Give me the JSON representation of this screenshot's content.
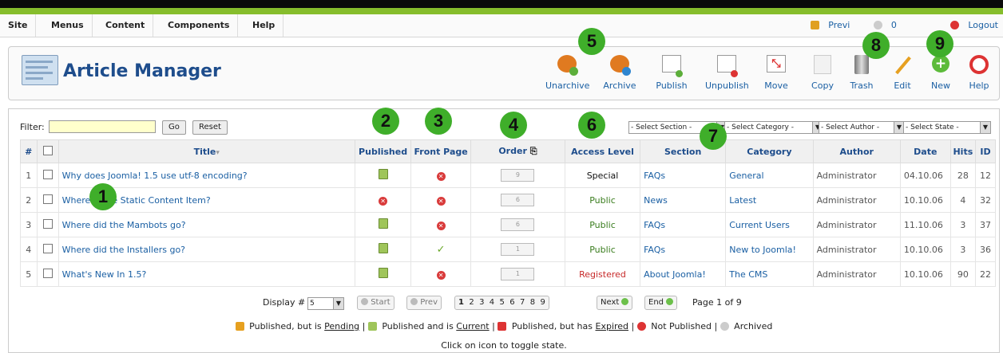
{
  "menubar": {
    "items": [
      "Site",
      "Menus",
      "Content",
      "Components",
      "Help"
    ],
    "preview": "Previ",
    "messages_count": "0",
    "logout": "Logout"
  },
  "header": {
    "title": "Article Manager"
  },
  "toolbar": {
    "buttons": [
      "Unarchive",
      "Archive",
      "Publish",
      "Unpublish",
      "Move",
      "Copy",
      "Trash",
      "Edit",
      "New",
      "Help"
    ]
  },
  "filter": {
    "label": "Filter:",
    "value": "",
    "go": "Go",
    "reset": "Reset",
    "selects": [
      "- Select Section -",
      "- Select Category -",
      "- Select Author -",
      "- Select State -"
    ]
  },
  "table": {
    "columns": [
      "#",
      "",
      "Title",
      "Published",
      "Front Page",
      "Order",
      "Access Level",
      "Section",
      "Category",
      "Author",
      "Date",
      "Hits",
      "ID"
    ],
    "rows": [
      {
        "num": "1",
        "title": "Why does Joomla! 1.5 use utf-8 encoding?",
        "published": "pub",
        "front": "no",
        "order": "9",
        "access": "Special",
        "section": "FAQs",
        "category": "General",
        "author": "Administrator",
        "date": "04.10.06",
        "hits": "28",
        "id": "12"
      },
      {
        "num": "2",
        "title": "Where is the Static Content Item?",
        "published": "unpub",
        "front": "no",
        "order": "6",
        "access": "Public",
        "section": "News",
        "category": "Latest",
        "author": "Administrator",
        "date": "10.10.06",
        "hits": "4",
        "id": "32"
      },
      {
        "num": "3",
        "title": "Where did the Mambots go?",
        "published": "pub",
        "front": "no",
        "order": "6",
        "access": "Public",
        "section": "FAQs",
        "category": "Current Users",
        "author": "Administrator",
        "date": "11.10.06",
        "hits": "3",
        "id": "37"
      },
      {
        "num": "4",
        "title": "Where did the Installers go?",
        "published": "pub",
        "front": "yes",
        "order": "1",
        "access": "Public",
        "section": "FAQs",
        "category": "New to Joomla!",
        "author": "Administrator",
        "date": "10.10.06",
        "hits": "3",
        "id": "36"
      },
      {
        "num": "5",
        "title": "What's New In 1.5?",
        "published": "pub",
        "front": "no",
        "order": "1",
        "access": "Registered",
        "section": "About Joomla!",
        "category": "The CMS",
        "author": "Administrator",
        "date": "10.10.06",
        "hits": "90",
        "id": "22"
      }
    ]
  },
  "pager": {
    "display_label": "Display #",
    "display_value": "5",
    "start": "Start",
    "prev": "Prev",
    "pages": [
      "1",
      "2",
      "3",
      "4",
      "5",
      "6",
      "7",
      "8",
      "9"
    ],
    "next": "Next",
    "end": "End",
    "page_info": "Page 1 of 9"
  },
  "legend": {
    "pending_a": "Published, but is",
    "pending_b": "Pending",
    "current_a": "Published and is",
    "current_b": "Current",
    "expired_a": "Published, but has",
    "expired_b": "Expired",
    "notpub": "Not Published",
    "archived": "Archived",
    "hint": "Click on icon to toggle state."
  },
  "badges": [
    "1",
    "2",
    "3",
    "4",
    "5",
    "6",
    "7",
    "8",
    "9"
  ],
  "colors": {
    "accent_green": "#86bd2c",
    "title_blue": "#1e4d8c",
    "badge_green": "#3fae2a"
  }
}
